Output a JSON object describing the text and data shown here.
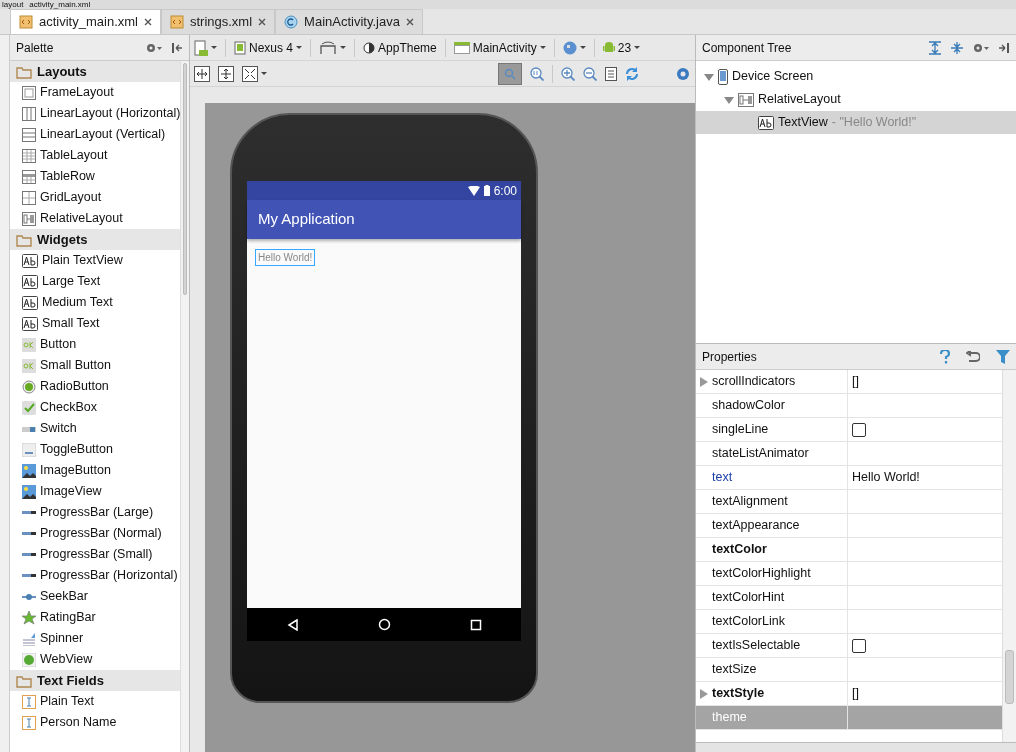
{
  "breadcrumb": [
    "layout",
    "activity_main.xml"
  ],
  "tabs": [
    {
      "label": "activity_main.xml",
      "kind": "xml",
      "selected": true
    },
    {
      "label": "strings.xml",
      "kind": "xml",
      "selected": false
    },
    {
      "label": "MainActivity.java",
      "kind": "class",
      "selected": false
    }
  ],
  "palette": {
    "title": "Palette",
    "groups": [
      {
        "title": "Layouts",
        "items": [
          {
            "label": "FrameLayout",
            "kind": "frame"
          },
          {
            "label": "LinearLayout (Horizontal)",
            "kind": "linear-h"
          },
          {
            "label": "LinearLayout (Vertical)",
            "kind": "linear-v"
          },
          {
            "label": "TableLayout",
            "kind": "table"
          },
          {
            "label": "TableRow",
            "kind": "tablerow"
          },
          {
            "label": "GridLayout",
            "kind": "grid"
          },
          {
            "label": "RelativeLayout",
            "kind": "relative"
          }
        ]
      },
      {
        "title": "Widgets",
        "items": [
          {
            "label": "Plain TextView",
            "kind": "text"
          },
          {
            "label": "Large Text",
            "kind": "text"
          },
          {
            "label": "Medium Text",
            "kind": "text"
          },
          {
            "label": "Small Text",
            "kind": "text"
          },
          {
            "label": "Button",
            "kind": "button"
          },
          {
            "label": "Small Button",
            "kind": "button"
          },
          {
            "label": "RadioButton",
            "kind": "radio"
          },
          {
            "label": "CheckBox",
            "kind": "checkbox"
          },
          {
            "label": "Switch",
            "kind": "switch"
          },
          {
            "label": "ToggleButton",
            "kind": "toggle"
          },
          {
            "label": "ImageButton",
            "kind": "image"
          },
          {
            "label": "ImageView",
            "kind": "image"
          },
          {
            "label": "ProgressBar (Large)",
            "kind": "progress"
          },
          {
            "label": "ProgressBar (Normal)",
            "kind": "progress"
          },
          {
            "label": "ProgressBar (Small)",
            "kind": "progress"
          },
          {
            "label": "ProgressBar (Horizontal)",
            "kind": "progress"
          },
          {
            "label": "SeekBar",
            "kind": "seekbar"
          },
          {
            "label": "RatingBar",
            "kind": "rating"
          },
          {
            "label": "Spinner",
            "kind": "spinner"
          },
          {
            "label": "WebView",
            "kind": "web"
          }
        ]
      },
      {
        "title": "Text Fields",
        "items": [
          {
            "label": "Plain Text",
            "kind": "edit"
          },
          {
            "label": "Person Name",
            "kind": "edit"
          }
        ]
      }
    ]
  },
  "toolbar": {
    "device": "Nexus 4",
    "theme": "AppTheme",
    "activity": "MainActivity",
    "api": "23"
  },
  "phone": {
    "time": "6:00",
    "app_title": "My Application",
    "text": "Hello World!"
  },
  "component_tree": {
    "title": "Component Tree",
    "nodes": [
      {
        "label": "Device Screen",
        "kind": "device",
        "expanded": true,
        "selected": false,
        "children": [
          {
            "label": "RelativeLayout",
            "kind": "relative",
            "expanded": true,
            "selected": false,
            "children": [
              {
                "label": "TextView",
                "detail": "- \"Hello World!\"",
                "kind": "text",
                "selected": true
              }
            ]
          }
        ]
      }
    ]
  },
  "properties": {
    "title": "Properties",
    "rows": [
      {
        "name": "scrollIndicators",
        "value": "[]",
        "expandable": true,
        "modified": false,
        "bold": false,
        "selected": false
      },
      {
        "name": "shadowColor",
        "expandable": false,
        "modified": false,
        "bold": false,
        "selected": false
      },
      {
        "name": "singleLine",
        "kind": "checkbox",
        "checked": false,
        "expandable": false,
        "modified": false,
        "bold": false,
        "selected": false
      },
      {
        "name": "stateListAnimator",
        "expandable": false,
        "modified": false,
        "bold": false,
        "selected": false
      },
      {
        "name": "text",
        "value": "Hello World!",
        "expandable": false,
        "modified": true,
        "bold": false,
        "selected": false
      },
      {
        "name": "textAlignment",
        "expandable": false,
        "modified": false,
        "bold": false,
        "selected": false
      },
      {
        "name": "textAppearance",
        "expandable": false,
        "modified": false,
        "bold": false,
        "selected": false
      },
      {
        "name": "textColor",
        "expandable": false,
        "modified": false,
        "bold": true,
        "selected": false
      },
      {
        "name": "textColorHighlight",
        "expandable": false,
        "modified": false,
        "bold": false,
        "selected": false
      },
      {
        "name": "textColorHint",
        "expandable": false,
        "modified": false,
        "bold": false,
        "selected": false
      },
      {
        "name": "textColorLink",
        "expandable": false,
        "modified": false,
        "bold": false,
        "selected": false
      },
      {
        "name": "textIsSelectable",
        "kind": "checkbox",
        "checked": false,
        "expandable": false,
        "modified": false,
        "bold": false,
        "selected": false
      },
      {
        "name": "textSize",
        "expandable": false,
        "modified": false,
        "bold": false,
        "selected": false
      },
      {
        "name": "textStyle",
        "value": "[]",
        "expandable": true,
        "modified": false,
        "bold": true,
        "selected": false
      },
      {
        "name": "theme",
        "expandable": false,
        "modified": false,
        "bold": false,
        "selected": true
      }
    ]
  }
}
